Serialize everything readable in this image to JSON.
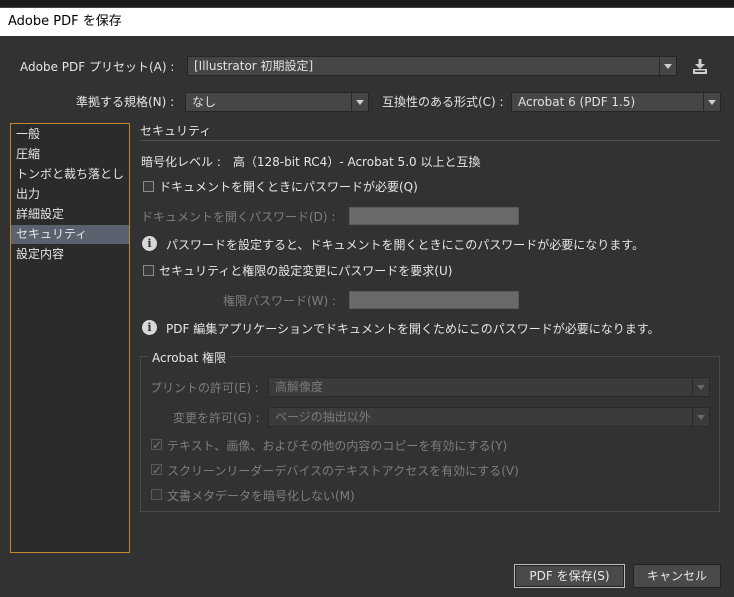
{
  "window": {
    "title": "Adobe PDF を保存"
  },
  "preset": {
    "label": "Adobe PDF プリセット(A) :",
    "value": "[Illustrator 初期設定]",
    "save_icon": "save-preset-icon"
  },
  "standard": {
    "label": "準拠する規格(N) :",
    "value": "なし"
  },
  "compatibility": {
    "label": "互換性のある形式(C) :",
    "value": "Acrobat 6 (PDF 1.5)"
  },
  "sidebar": {
    "items": [
      {
        "label": "一般",
        "selected": false
      },
      {
        "label": "圧縮",
        "selected": false
      },
      {
        "label": "トンボと裁ち落とし",
        "selected": false
      },
      {
        "label": "出力",
        "selected": false
      },
      {
        "label": "詳細設定",
        "selected": false
      },
      {
        "label": "セキュリティ",
        "selected": true
      },
      {
        "label": "設定内容",
        "selected": false
      }
    ]
  },
  "security": {
    "section_title": "セキュリティ",
    "encryption_level": "暗号化レベル :　高（128-bit RC4）- Acrobat 5.0 以上と互換",
    "open_password": {
      "checkbox_label": "ドキュメントを開くときにパスワードが必要(Q)",
      "checked": false,
      "field_label": "ドキュメントを開くパスワード(D) :",
      "value": "",
      "info": "パスワードを設定すると、ドキュメントを開くときにこのパスワードが必要になります。"
    },
    "permissions_password": {
      "checkbox_label": "セキュリティと権限の設定変更にパスワードを要求(U)",
      "checked": false,
      "field_label": "権限パスワード(W) :",
      "value": "",
      "info": "PDF 編集アプリケーションでドキュメントを開くためにこのパスワードが必要になります。"
    },
    "acrobat_permissions": {
      "title": "Acrobat 権限",
      "printing": {
        "label": "プリントの許可(E) :",
        "value": "高解像度"
      },
      "changes": {
        "label": "変更を許可(G) :",
        "value": "ページの抽出以外"
      },
      "options": [
        {
          "label": "テキスト、画像、およびその他の内容のコピーを有効にする(Y)",
          "checked": true
        },
        {
          "label": "スクリーンリーダーデバイスのテキストアクセスを有効にする(V)",
          "checked": true
        },
        {
          "label": "文書メタデータを暗号化しない(M)",
          "checked": false
        }
      ]
    }
  },
  "buttons": {
    "save": "PDF を保存(S)",
    "cancel": "キャンセル"
  }
}
